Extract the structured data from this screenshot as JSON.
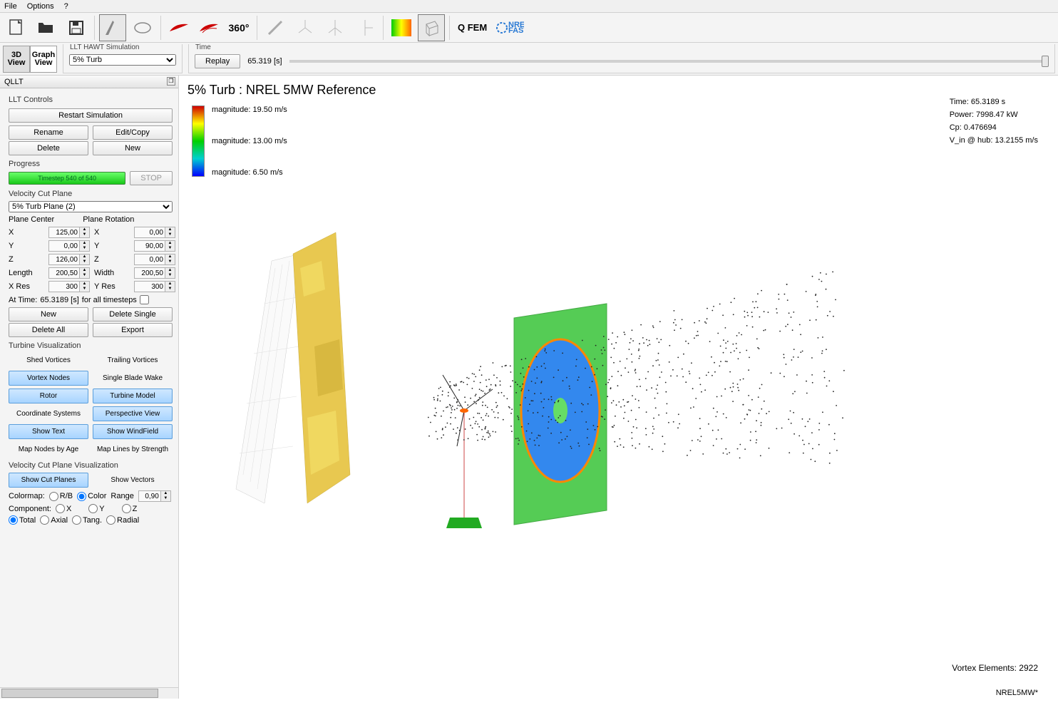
{
  "menu": {
    "file": "File",
    "options": "Options",
    "help": "?"
  },
  "toolbar_icons": [
    "new-file",
    "open-folder",
    "save",
    "blade",
    "airfoil",
    "polar-a",
    "polar-b",
    "360",
    "rotor-design",
    "turbine-a",
    "turbine-b",
    "turbine-c",
    "heatmap",
    "cube",
    "qfem",
    "nrel-fast"
  ],
  "toolbar_qfem": "Q FEM",
  "viewbtns": {
    "v3d_l1": "3D",
    "v3d_l2": "View",
    "graph_l1": "Graph",
    "graph_l2": "View"
  },
  "simgroup": {
    "label": "LLT HAWT Simulation",
    "selected": "5% Turb"
  },
  "timegroup": {
    "label": "Time",
    "replay": "Replay",
    "value": "65.319 [s]"
  },
  "dock": {
    "title": "QLLT",
    "controls_label": "LLT Controls",
    "restart": "Restart Simulation",
    "rename": "Rename",
    "editcopy": "Edit/Copy",
    "delete": "Delete",
    "new": "New",
    "progress_label": "Progress",
    "progress_text": "Timestep 540 of 540",
    "stop": "STOP",
    "vcp_label": "Velocity Cut Plane",
    "vcp_selected": "5% Turb Plane (2)",
    "plane_center": "Plane Center",
    "plane_rotation": "Plane Rotation",
    "coords": {
      "cx_l": "X",
      "cx": "125,00",
      "rx_l": "X",
      "rx": "0,00",
      "cy_l": "Y",
      "cy": "0,00",
      "ry_l": "Y",
      "ry": "90,00",
      "cz_l": "Z",
      "cz": "126,00",
      "rz_l": "Z",
      "rz": "0,00",
      "len_l": "Length",
      "len": "200,50",
      "wid_l": "Width",
      "wid": "200,50",
      "xres_l": "X Res",
      "xres": "300",
      "yres_l": "Y Res",
      "yres": "300"
    },
    "attime_l": "At Time:",
    "attime_v": "65.3189 [s]",
    "allts": "for all timesteps",
    "vcp_new": "New",
    "vcp_delsingle": "Delete Single",
    "vcp_delall": "Delete All",
    "vcp_export": "Export",
    "tv_label": "Turbine Visualization",
    "tv": {
      "shed": "Shed Vortices",
      "trail": "Trailing Vortices",
      "nodes": "Vortex Nodes",
      "sbw": "Single Blade Wake",
      "rotor": "Rotor",
      "model": "Turbine Model",
      "coord": "Coordinate Systems",
      "persp": "Perspective View",
      "text": "Show Text",
      "wind": "Show WindField",
      "mapnodes": "Map Nodes by Age",
      "maplines": "Map Lines by Strength"
    },
    "vcpv_label": "Velocity Cut Plane Visualization",
    "vcpv_showcut": "Show Cut Planes",
    "vcpv_showvec": "Show Vectors",
    "colormap_l": "Colormap:",
    "rb": "R/B",
    "color": "Color",
    "range_l": "Range",
    "range_v": "0,90",
    "component_l": "Component:",
    "comp_x": "X",
    "comp_y": "Y",
    "comp_z": "Z",
    "comp_total": "Total",
    "comp_axial": "Axial",
    "comp_tang": "Tang.",
    "comp_radial": "Radial"
  },
  "viewport": {
    "title": "5% Turb : NREL 5MW Reference",
    "mag_hi": "magnitude: 19.50 m/s",
    "mag_mid": "magnitude: 13.00 m/s",
    "mag_lo": "magnitude: 6.50 m/s",
    "time": "Time: 65.3189 s",
    "power": "Power: 7998.47 kW",
    "cp": "Cp: 0.476694",
    "vin": "V_in @ hub: 13.2155 m/s",
    "vortex_elems": "Vortex Elements: 2922",
    "footer": "NREL5MW*"
  }
}
